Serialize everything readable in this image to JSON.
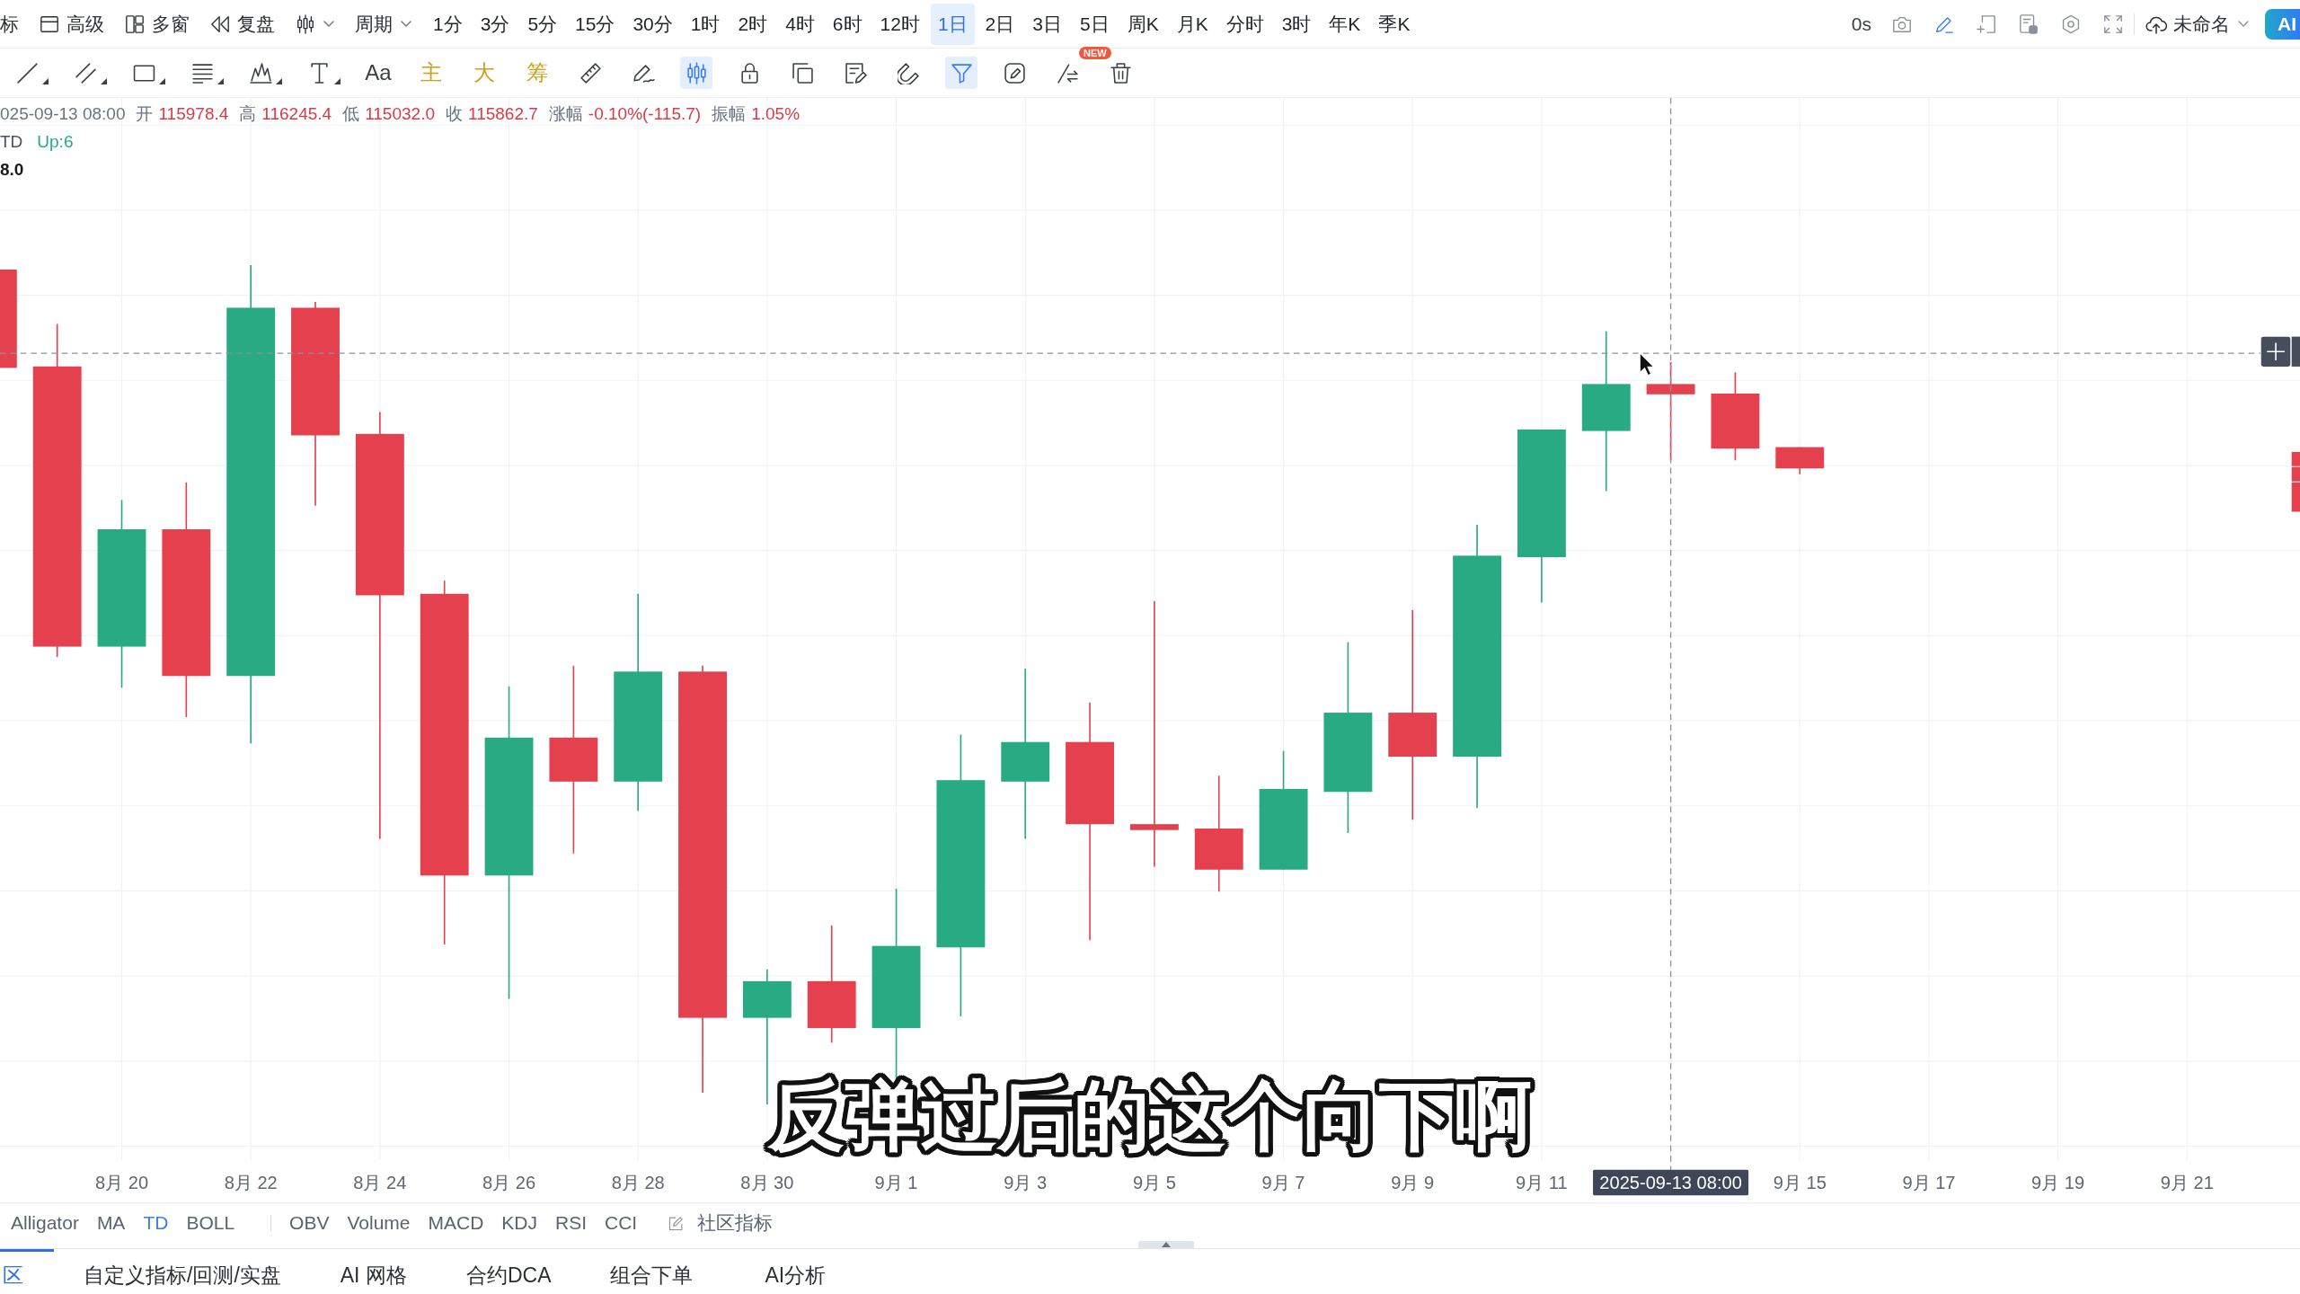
{
  "top_toolbar": {
    "tools": [
      {
        "label": "标",
        "dropdown": false
      },
      {
        "label": "高级",
        "dropdown": false
      },
      {
        "label": "多窗",
        "dropdown": false
      },
      {
        "label": "复盘",
        "dropdown": false
      },
      {
        "dropdown": true
      },
      {
        "label": "周期",
        "dropdown": true
      }
    ],
    "periods": [
      {
        "label": "1分",
        "selected": false
      },
      {
        "label": "3分",
        "selected": false
      },
      {
        "label": "5分",
        "selected": false
      },
      {
        "label": "15分",
        "selected": false
      },
      {
        "label": "30分",
        "selected": false
      },
      {
        "label": "1时",
        "selected": false
      },
      {
        "label": "2时",
        "selected": false
      },
      {
        "label": "4时",
        "selected": false
      },
      {
        "label": "6时",
        "selected": false
      },
      {
        "label": "12时",
        "selected": false
      },
      {
        "label": "1日",
        "selected": true
      },
      {
        "label": "2日",
        "selected": false
      },
      {
        "label": "3日",
        "selected": false
      },
      {
        "label": "5日",
        "selected": false
      },
      {
        "label": "周K",
        "selected": false
      },
      {
        "label": "月K",
        "selected": false
      },
      {
        "label": "分时",
        "selected": false
      },
      {
        "label": "3时",
        "selected": false
      },
      {
        "label": "年K",
        "selected": false
      },
      {
        "label": "季K",
        "selected": false
      }
    ],
    "timer": "0s",
    "actions": [
      {
        "active": false
      },
      {
        "active": true
      },
      {
        "active": false
      },
      {
        "active": false
      },
      {
        "active": false
      },
      {
        "active": false
      }
    ],
    "layout_name": "未命名",
    "ai_button": "AI"
  },
  "drawing_toolbar": {
    "tools": [
      {
        "dropdown": true,
        "active": false
      },
      {
        "dropdown": true,
        "active": false
      },
      {
        "dropdown": true,
        "active": false
      },
      {
        "dropdown": true,
        "active": false
      },
      {
        "dropdown": true,
        "active": false
      },
      {
        "dropdown": true,
        "active": false
      },
      {
        "label": "Aa",
        "color": "#3a3f48",
        "dropdown": false,
        "active": false
      },
      {
        "label": "主",
        "color": "#c9a01c",
        "dropdown": false,
        "active": false
      },
      {
        "label": "大",
        "color": "#c9a01c",
        "dropdown": false,
        "active": false
      },
      {
        "label": "筹",
        "color": "#c9a01c",
        "dropdown": false,
        "active": false
      },
      {
        "dropdown": false,
        "active": false
      },
      {
        "dropdown": false,
        "active": false
      },
      {
        "dropdown": false,
        "active": true
      },
      {
        "dropdown": false,
        "active": false
      },
      {
        "dropdown": false,
        "active": false
      },
      {
        "dropdown": false,
        "active": false
      },
      {
        "dropdown": false,
        "active": false
      },
      {
        "dropdown": false,
        "active": true
      },
      {
        "dropdown": false,
        "active": false
      },
      {
        "dropdown": false,
        "active": false,
        "badge": "NEW"
      },
      {
        "dropdown": false,
        "active": false
      }
    ]
  },
  "chart": {
    "info": {
      "time": "025-09-13 08:00",
      "rising": false,
      "fields": [
        {
          "label": "开",
          "value": "115978.4"
        },
        {
          "label": "高",
          "value": "116245.4"
        },
        {
          "label": "低",
          "value": "115032.0"
        },
        {
          "label": "收",
          "value": "115862.7"
        },
        {
          "label": "涨幅",
          "value": "-0.10%(-115.7)"
        },
        {
          "label": "振幅",
          "value": "1.05%"
        }
      ]
    },
    "indicator": {
      "name": "TD",
      "value": "Up:6"
    },
    "reading": "8.0",
    "x_axis": [
      {
        "kind": "date",
        "label": "8月 20"
      },
      {
        "kind": "date",
        "label": "8月 22"
      },
      {
        "kind": "date",
        "label": "8月 24"
      },
      {
        "kind": "date",
        "label": "8月 26"
      },
      {
        "kind": "date",
        "label": "8月 28"
      },
      {
        "kind": "date",
        "label": "8月 30"
      },
      {
        "kind": "date",
        "label": "9月 1"
      },
      {
        "kind": "date",
        "label": "9月 3"
      },
      {
        "kind": "date",
        "label": "9月 5"
      },
      {
        "kind": "date",
        "label": "9月 7"
      },
      {
        "kind": "date",
        "label": "9月 9"
      },
      {
        "kind": "date",
        "label": "9月 11"
      },
      {
        "kind": "crosshair",
        "label": "2025-09-13 08:00"
      },
      {
        "kind": "date",
        "label": "9月 15"
      },
      {
        "kind": "date",
        "label": "9月 17"
      },
      {
        "kind": "date",
        "label": "9月 19"
      },
      {
        "kind": "date",
        "label": "9月 21"
      }
    ],
    "subtitle": "反弹过后的这个向下啊"
  },
  "indicator_bar": {
    "main": [
      {
        "label": "Alligator",
        "selected": false
      },
      {
        "label": "MA",
        "selected": false
      },
      {
        "label": "TD",
        "selected": true
      },
      {
        "label": "BOLL",
        "selected": false
      }
    ],
    "sub": [
      {
        "label": "OBV",
        "selected": false
      },
      {
        "label": "Volume",
        "selected": false
      },
      {
        "label": "MACD",
        "selected": false
      },
      {
        "label": "KDJ",
        "selected": false
      },
      {
        "label": "RSI",
        "selected": false
      },
      {
        "label": "CCI",
        "selected": false
      }
    ],
    "community": "社区指标"
  },
  "bottom_tabs": [
    {
      "label": "区",
      "selected": true
    },
    {
      "label": "自定义指标/回测/实盘",
      "selected": false
    },
    {
      "label": "AI 网格",
      "selected": false
    },
    {
      "label": "合约DCA",
      "selected": false
    },
    {
      "label": "组合下单",
      "selected": false
    },
    {
      "label": "AI分析",
      "selected": false
    }
  ]
}
